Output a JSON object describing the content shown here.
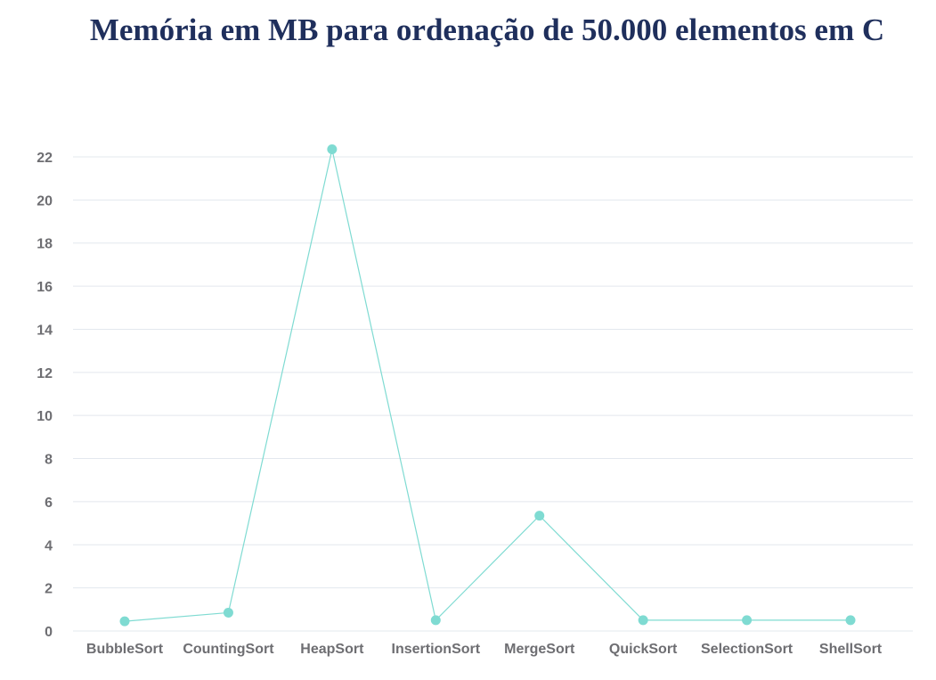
{
  "chart_data": {
    "type": "line",
    "title": "Memória em MB para ordenação de 50.000 elementos em C",
    "xlabel": "",
    "ylabel": "",
    "categories": [
      "BubbleSort",
      "CountingSort",
      "HeapSort",
      "InsertionSort",
      "MergeSort",
      "QuickSort",
      "SelectionSort",
      "ShellSort"
    ],
    "series": [
      {
        "values": [
          0.45,
          0.85,
          22.35,
          0.5,
          5.35,
          0.5,
          0.5,
          0.5
        ],
        "color": "#7fdbd2"
      }
    ],
    "ylim": [
      0,
      22
    ],
    "yticks": [
      0,
      2,
      4,
      6,
      8,
      10,
      12,
      14,
      16,
      18,
      20,
      22
    ],
    "grid": true,
    "colors": {
      "title": "#1f2f5c",
      "gridline": "#e3e8ee",
      "tick_label": "#6e6e72",
      "line": "#7fdbd2"
    }
  }
}
